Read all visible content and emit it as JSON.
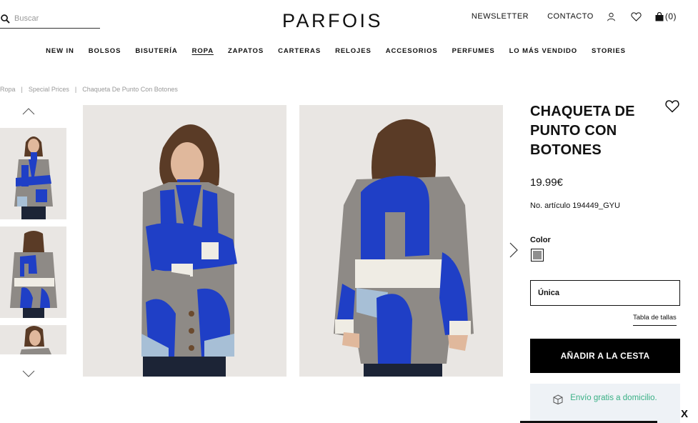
{
  "header": {
    "search_placeholder": "Buscar",
    "logo_text": "PARFOIS",
    "links": {
      "newsletter": "NEWSLETTER",
      "contact": "CONTACTO"
    },
    "cart_count": "(0)"
  },
  "nav": [
    "NEW IN",
    "BOLSOS",
    "BISUTERÍA",
    "ROPA",
    "ZAPATOS",
    "CARTERAS",
    "RELOJES",
    "ACCESORIOS",
    "PERFUMES",
    "LO MÁS VENDIDO",
    "STORIES"
  ],
  "nav_active": "ROPA",
  "breadcrumb": {
    "b0": "Ropa",
    "b1": "Special Prices",
    "b2": "Chaqueta De Punto Con Botones"
  },
  "product": {
    "title": "CHAQUETA DE PUNTO CON BOTONES",
    "price": "19.99€",
    "sku": "No. artículo 194449_GYU",
    "color_label": "Color",
    "swatch_color": "#8f8f8f",
    "size": "Única",
    "size_guide": "Tabla de tallas",
    "add_to_cart": "AÑADIR A LA CESTA",
    "shipping": "Envío gratis a domicilio."
  },
  "close_label": "X",
  "colors": {
    "sweater_grey": "#8e8a86",
    "sweater_blue": "#1f3fc6",
    "cream": "#efece4",
    "light_blue": "#a7bfd6",
    "bg": "#e9e6e3",
    "shipping_text": "#39b085"
  }
}
